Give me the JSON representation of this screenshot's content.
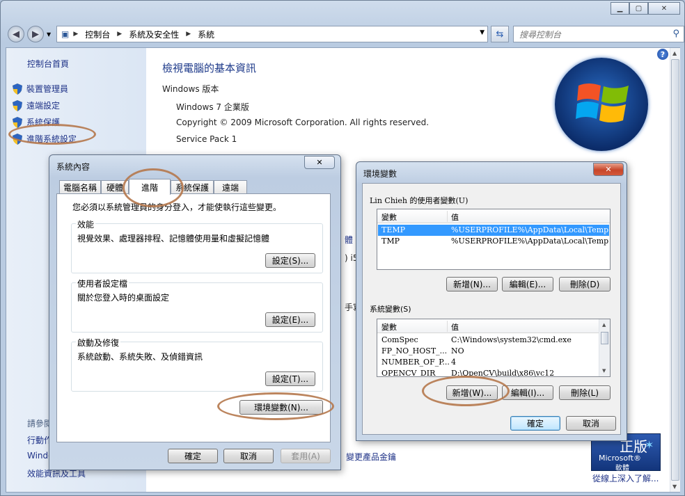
{
  "control_panel": {
    "address": {
      "segments": [
        "控制台",
        "系統及安全性",
        "系統"
      ]
    },
    "search_placeholder": "搜尋控制台",
    "sidebar": {
      "home": "控制台首頁",
      "links": [
        "裝置管理員",
        "遠端設定",
        "系統保護",
        "進階系統設定"
      ],
      "see_also_head": "請參閱",
      "bottom_links": [
        "行動作",
        "Windo",
        "效能資訊及工具"
      ]
    },
    "main": {
      "title": "檢視電腦的基本資訊",
      "edition_label": "Windows 版本",
      "edition": "Windows 7 企業版",
      "copyright": "Copyright © 2009 Microsoft Corporation.  All rights reserved.",
      "service_pack": "Service Pack 1",
      "peek_1": "體",
      "peek_2": ") i5",
      "peek_3": "手寫",
      "product_key_link": "變更產品金鑰"
    },
    "genuine": {
      "big": "正版",
      "brand": "Microsoft®",
      "software": "軟體",
      "link": "從線上深入了解..."
    }
  },
  "system_props": {
    "title": "系統內容",
    "close": "✕",
    "tabs": [
      "電腦名稱",
      "硬體",
      "進階",
      "系統保護",
      "遠端"
    ],
    "note": "您必須以系統管理員的身分登入，才能使執行這些變更。",
    "groups": [
      {
        "title": "效能",
        "text": "視覺效果、處理器排程、記憶體使用量和虛擬記憶體",
        "button": "設定(S)..."
      },
      {
        "title": "使用者設定檔",
        "text": "關於您登入時的桌面設定",
        "button": "設定(E)..."
      },
      {
        "title": "啟動及修復",
        "text": "系統啟動、系統失敗、及偵錯資訊",
        "button": "設定(T)..."
      }
    ],
    "env_button": "環境變數(N)...",
    "ok": "確定",
    "cancel": "取消",
    "apply": "套用(A)"
  },
  "env_vars": {
    "title": "環境變數",
    "close": "✕",
    "user_label": "Lin Chieh 的使用者變數(U)",
    "system_label": "系統變數(S)",
    "col_var": "變數",
    "col_val": "值",
    "user_rows": [
      {
        "name": "TEMP",
        "value": "%USERPROFILE%\\AppData\\Local\\Temp"
      },
      {
        "name": "TMP",
        "value": "%USERPROFILE%\\AppData\\Local\\Temp"
      }
    ],
    "system_rows": [
      {
        "name": "ComSpec",
        "value": "C:\\Windows\\system32\\cmd.exe"
      },
      {
        "name": "FP_NO_HOST_...",
        "value": "NO"
      },
      {
        "name": "NUMBER_OF_P...",
        "value": "4"
      },
      {
        "name": "OPENCV_DIR",
        "value": "D:\\OpenCV\\build\\x86\\vc12"
      }
    ],
    "new_user": "新增(N)...",
    "edit_user": "編輯(E)...",
    "delete_user": "刪除(D)",
    "new_sys": "新增(W)...",
    "edit_sys": "編輯(I)...",
    "delete_sys": "刪除(L)",
    "ok": "確定",
    "cancel": "取消"
  }
}
